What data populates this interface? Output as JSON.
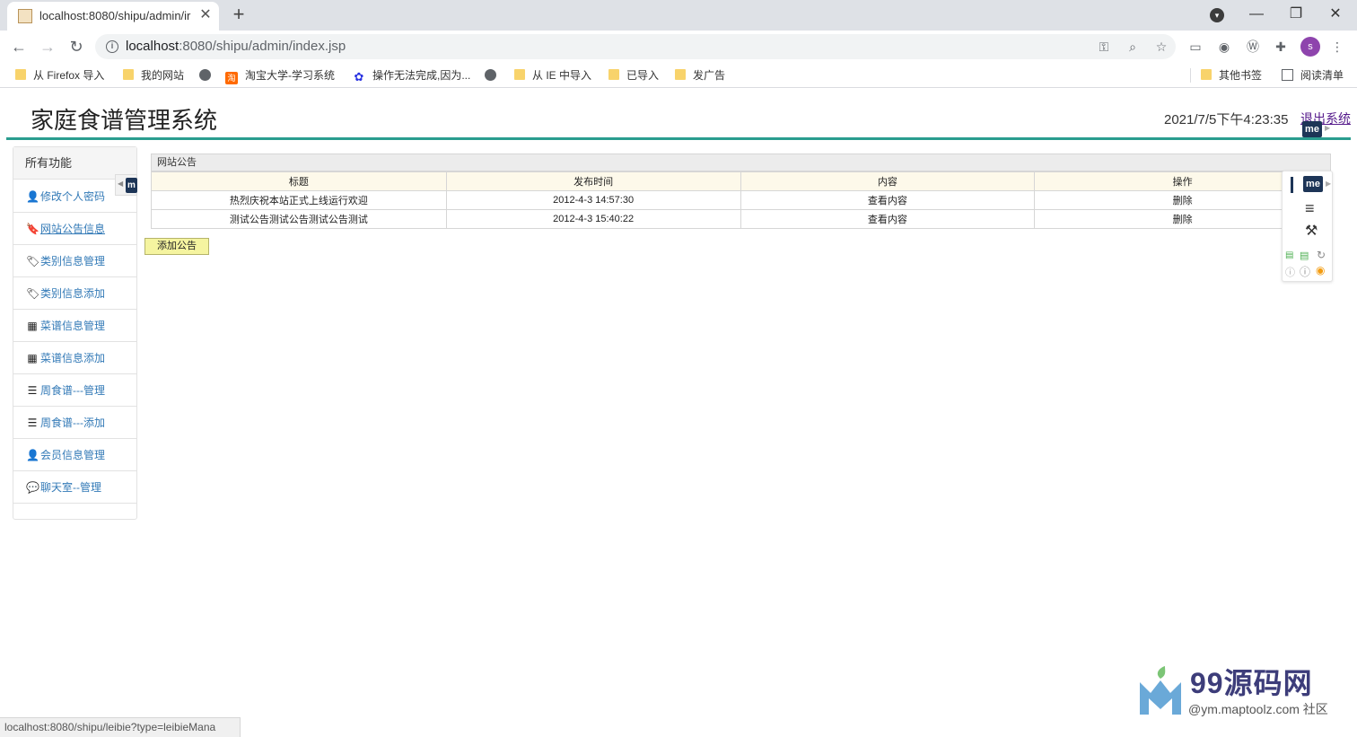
{
  "browser": {
    "tab_title": "localhost:8080/shipu/admin/ir",
    "tab_close": "✕",
    "new_tab": "+",
    "url_host": "localhost",
    "url_rest": ":8080/shipu/admin/index.jsp",
    "window_min": "—",
    "window_max": "❐",
    "window_close": "✕",
    "avatar_letter": "s",
    "status_url": "localhost:8080/shipu/leibie?type=leibieMana"
  },
  "bookmarks": {
    "items": [
      {
        "label": "从 Firefox 导入",
        "icon": "folder-icon"
      },
      {
        "label": "我的网站",
        "icon": "folder-icon"
      },
      {
        "label": "",
        "icon": "globe-icon"
      },
      {
        "label": "淘宝大学-学习系统",
        "icon": "taobao-icon"
      },
      {
        "label": "操作无法完成,因为...",
        "icon": "baidu-icon"
      },
      {
        "label": "",
        "icon": "globe-icon"
      },
      {
        "label": "从 IE 中导入",
        "icon": "folder-icon"
      },
      {
        "label": "已导入",
        "icon": "folder-icon"
      },
      {
        "label": "发广告",
        "icon": "folder-icon"
      }
    ],
    "other": "其他书签",
    "reading_list": "阅读清单"
  },
  "header": {
    "title": "家庭食谱管理系统",
    "datetime": "2021/7/5下午4:23:35",
    "logout": "退出系统"
  },
  "sidebar": {
    "heading": "所有功能",
    "items": [
      {
        "label": "修改个人密码",
        "icon": "user-icon"
      },
      {
        "label": "网站公告信息",
        "icon": "bookmark-icon"
      },
      {
        "label": "类别信息管理",
        "icon": "tags-icon"
      },
      {
        "label": "类别信息添加",
        "icon": "tags-icon"
      },
      {
        "label": "菜谱信息管理",
        "icon": "th-large-icon"
      },
      {
        "label": "菜谱信息添加",
        "icon": "th-large-icon"
      },
      {
        "label": "周食谱---管理",
        "icon": "list-icon"
      },
      {
        "label": "周食谱---添加",
        "icon": "list-icon"
      },
      {
        "label": "会员信息管理",
        "icon": "user-icon"
      },
      {
        "label": "聊天室--管理",
        "icon": "comment-icon"
      }
    ]
  },
  "notice_panel": {
    "title": "网站公告",
    "columns": [
      "标题",
      "发布时间",
      "内容",
      "操作"
    ],
    "rows": [
      {
        "title": "热烈庆祝本站正式上线运行欢迎",
        "time": "2012-4-3 14:57:30",
        "content": "查看内容",
        "action": "删除"
      },
      {
        "title": "测试公告测试公告测试公告测试",
        "time": "2012-4-3 15:40:22",
        "content": "查看内容",
        "action": "删除"
      }
    ],
    "add_button": "添加公告"
  },
  "extension": {
    "badge": "me"
  },
  "watermark": {
    "brand": "99源码网",
    "sub": "@ym.maptoolz.com 社区"
  },
  "colors": {
    "accent_teal": "#2a9d8f",
    "link_blue": "#337ab7",
    "add_button_bg": "#f5f4a0",
    "header_cell_bg": "#fdf9ea"
  }
}
